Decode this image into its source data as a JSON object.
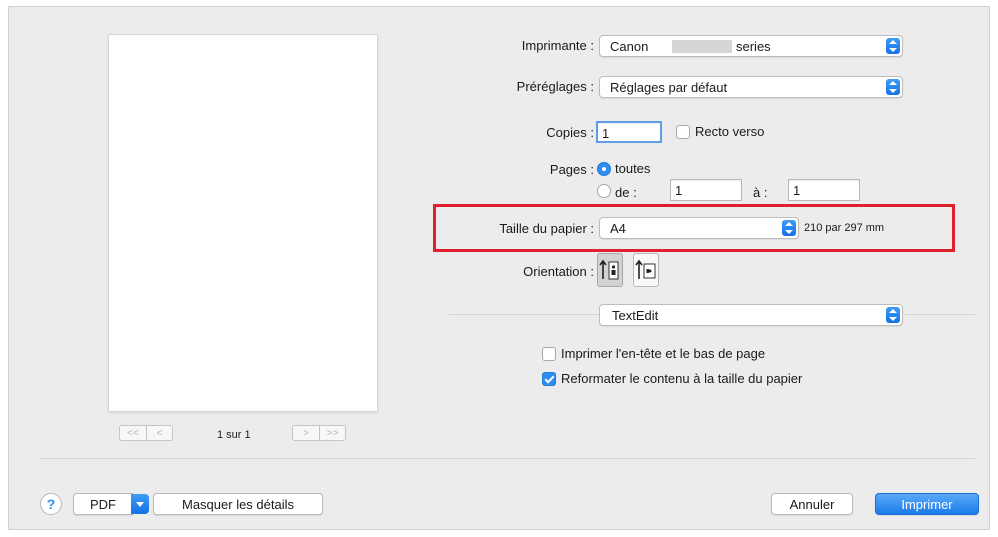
{
  "printer": {
    "label": "Imprimante :",
    "value": "Canon",
    "value_suffix": "series"
  },
  "presets": {
    "label": "Préréglages :",
    "value": "Réglages par défaut"
  },
  "copies": {
    "label": "Copies :",
    "value": "1",
    "duplex_label": "Recto verso",
    "duplex_checked": false
  },
  "pages": {
    "label": "Pages :",
    "all_label": "toutes",
    "range_label": "de :",
    "from": "1",
    "to_label": "à :",
    "to": "1",
    "selected": "all"
  },
  "paper_size": {
    "label": "Taille du papier :",
    "value": "A4",
    "dimensions": "210 par 297 mm"
  },
  "orientation": {
    "label": "Orientation :",
    "selected": "portrait",
    "portrait_icon": "portrait-orientation-icon",
    "landscape_icon": "landscape-orientation-icon"
  },
  "app_section": {
    "value": "TextEdit"
  },
  "options": [
    {
      "label": "Imprimer l'en-tête et le bas de page",
      "checked": false
    },
    {
      "label": "Reformater le contenu à la taille du papier",
      "checked": true
    }
  ],
  "preview": {
    "page_indicator": "1 sur 1",
    "first_icon": "<<",
    "prev_icon": "<",
    "next_icon": ">",
    "last_icon": ">>"
  },
  "footer": {
    "help_icon": "?",
    "pdf_label": "PDF",
    "details_label": "Masquer les détails",
    "cancel_label": "Annuler",
    "print_label": "Imprimer"
  },
  "colors": {
    "accent": "#2f8df2",
    "highlight_box": "#e0202c",
    "dialog_bg": "#ececec"
  }
}
